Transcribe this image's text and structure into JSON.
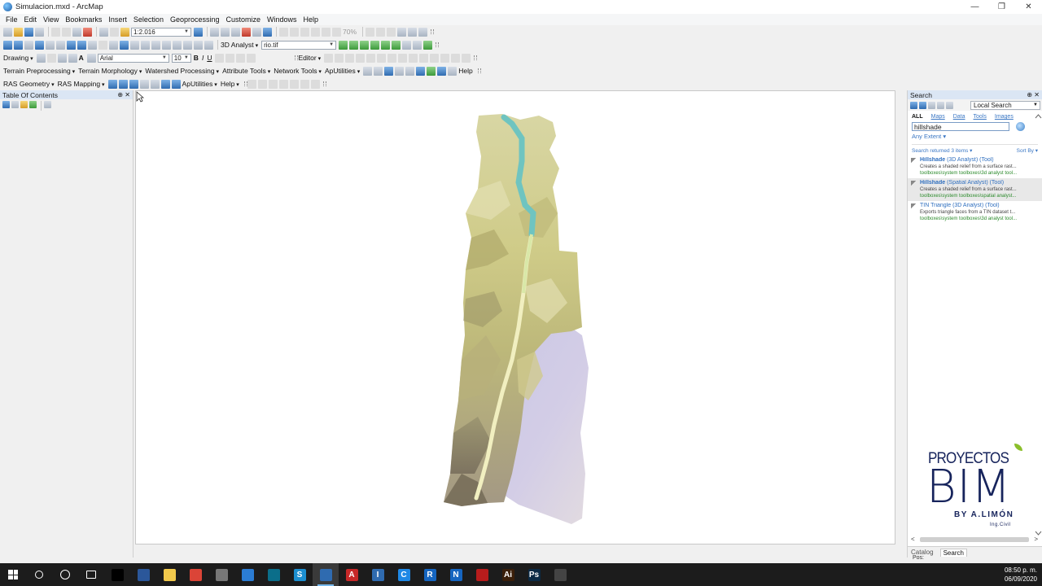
{
  "window": {
    "title": "Simulacion.mxd - ArcMap",
    "controls": [
      "—",
      "❐",
      "✕"
    ]
  },
  "menu": [
    "File",
    "Edit",
    "View",
    "Bookmarks",
    "Insert",
    "Selection",
    "Geoprocessing",
    "Customize",
    "Windows",
    "Help"
  ],
  "toolbar1": {
    "scale": "1:2.016",
    "zoom": "70%"
  },
  "toolbar2": {
    "analyst": "3D Analyst",
    "layer": "rio.tif"
  },
  "toolbar3": {
    "drawing": "Drawing",
    "font": "Arial",
    "size": "10",
    "bold": "B",
    "italic": "I",
    "underline": "U",
    "editor": "Editor"
  },
  "toolbar4": [
    "Terrain Preprocessing",
    "Terrain Morphology",
    "Watershed Processing",
    "Attribute Tools",
    "Network Tools",
    "ApUtilities",
    "Help"
  ],
  "toolbar5": [
    "RAS Geometry",
    "RAS Mapping",
    "ApUtilities",
    "Help"
  ],
  "toc": {
    "title": "Table Of Contents",
    "controls": "⊕ ✕"
  },
  "search": {
    "title": "Search",
    "controls": "⊕ ✕",
    "scope": "Local Search",
    "filters": [
      "ALL",
      "Maps",
      "Data",
      "Tools",
      "Images"
    ],
    "query": "hillshade",
    "extent": "Any Extent ▾",
    "returned": "Search returned 3 items ▾",
    "sort": "Sort By ▾",
    "results": [
      {
        "name": "Hillshade",
        "suffix": " (3D Analyst) (Tool)",
        "desc": "Creates a shaded relief from a surface rast...",
        "path": "toolboxes\\system toolboxes\\3d analyst tool..."
      },
      {
        "name": "Hillshade",
        "suffix": " (Spatial Analyst) (Tool)",
        "desc": "Creates a shaded relief from a surface rast...",
        "path": "toolboxes\\system toolboxes\\spatial analyst..."
      },
      {
        "name": "TIN Triangle",
        "suffix": " (3D Analyst) (Tool)",
        "desc": "Exports triangle faces from a TIN dataset t...",
        "path": "toolboxes\\system toolboxes\\3d analyst tool..."
      }
    ],
    "tabs": [
      "Catalog",
      "Search"
    ],
    "scroll_left": "<",
    "scroll_right": ">"
  },
  "logo": {
    "line1": "PROYECTOS",
    "line2": "BIM",
    "line3": "BY A.LIMÓN",
    "line4": "Ing.Civil"
  },
  "status": {
    "pos": "Pos:"
  },
  "taskbar": {
    "time": "08:50 p. m.",
    "date": "06/09/2020",
    "apps": [
      {
        "glyph": "",
        "color": "#000000"
      },
      {
        "glyph": "",
        "color": "#2b579a"
      },
      {
        "glyph": "",
        "color": "#f2c94c"
      },
      {
        "glyph": "",
        "color": "#db4437"
      },
      {
        "glyph": "",
        "color": "#777777"
      },
      {
        "glyph": "",
        "color": "#2b7cd3"
      },
      {
        "glyph": "",
        "color": "#0b6e8a"
      },
      {
        "glyph": "S",
        "color": "#1c8fd0"
      },
      {
        "glyph": "",
        "color": "#2f6bb0"
      },
      {
        "glyph": "A",
        "color": "#c62828"
      },
      {
        "glyph": "I",
        "color": "#2f6bb0"
      },
      {
        "glyph": "C",
        "color": "#1e88e5"
      },
      {
        "glyph": "R",
        "color": "#1565c0"
      },
      {
        "glyph": "N",
        "color": "#1565c0"
      },
      {
        "glyph": "",
        "color": "#b71c1c"
      },
      {
        "glyph": "Ai",
        "color": "#3a1f0a"
      },
      {
        "glyph": "Ps",
        "color": "#0b2a45"
      },
      {
        "glyph": "",
        "color": "#444444"
      }
    ]
  }
}
